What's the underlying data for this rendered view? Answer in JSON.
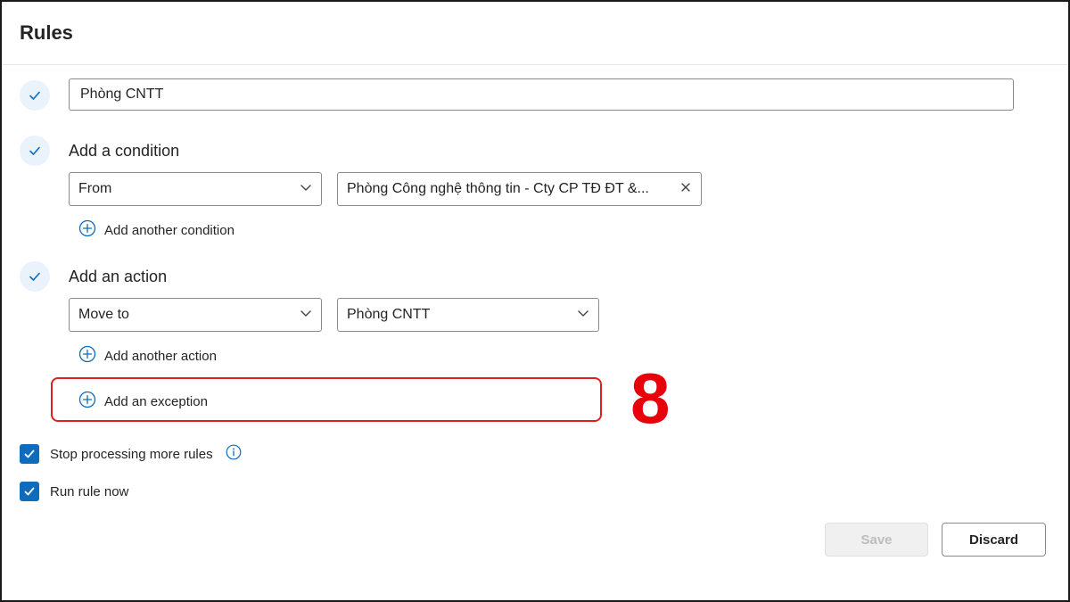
{
  "header": {
    "title": "Rules"
  },
  "rule_name": {
    "value": "Phòng CNTT"
  },
  "condition": {
    "heading": "Add a condition",
    "field": "From",
    "value": "Phòng Công nghệ thông tin - Cty CP TĐ ĐT &...",
    "add_label": "Add another condition"
  },
  "action": {
    "heading": "Add an action",
    "field": "Move to",
    "value": "Phòng CNTT",
    "add_label": "Add another action"
  },
  "exception": {
    "add_label": "Add an exception"
  },
  "annotation": {
    "step_number": "8",
    "color": "#e8000b"
  },
  "options": {
    "stop_processing": {
      "label": "Stop processing more rules",
      "checked": true
    },
    "run_now": {
      "label": "Run rule now",
      "checked": true
    }
  },
  "buttons": {
    "save": "Save",
    "discard": "Discard"
  },
  "colors": {
    "accent": "#0f6cbd",
    "highlight": "#e02020"
  },
  "icons": [
    "check-icon",
    "chevron-down-icon",
    "close-icon",
    "add-circle-icon",
    "info-icon"
  ]
}
